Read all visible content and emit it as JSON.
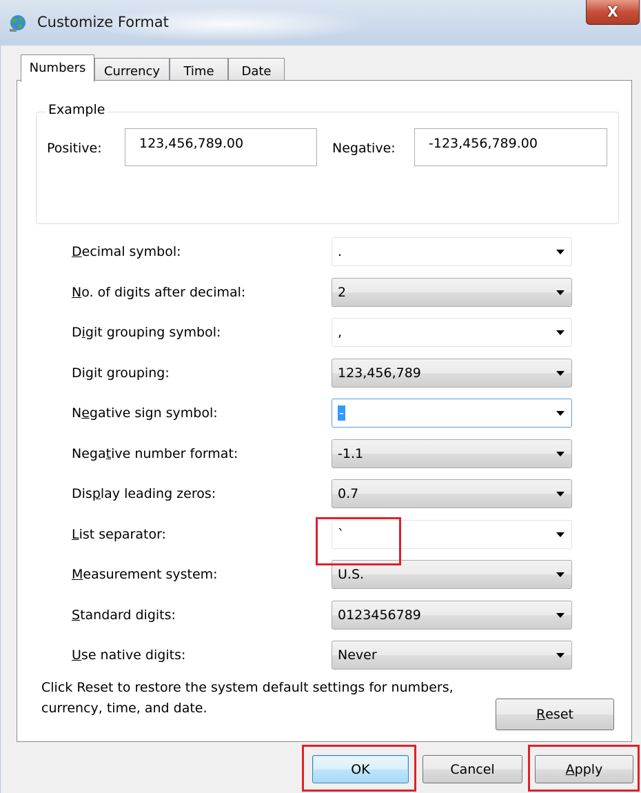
{
  "window": {
    "title": "Customize Format",
    "close_label": "X"
  },
  "tabs": [
    {
      "label": "Numbers",
      "active": true
    },
    {
      "label": "Currency",
      "active": false
    },
    {
      "label": "Time",
      "active": false
    },
    {
      "label": "Date",
      "active": false
    }
  ],
  "example": {
    "legend": "Example",
    "positive_label": "Positive:",
    "positive_value": "123,456,789.00",
    "negative_label": "Negative:",
    "negative_value": "-123,456,789.00"
  },
  "settings": [
    {
      "pre": "",
      "key": "D",
      "post": "ecimal symbol:",
      "value": ".",
      "style": "edit"
    },
    {
      "pre": "",
      "key": "N",
      "post": "o. of digits after decimal:",
      "value": "2",
      "style": "list"
    },
    {
      "pre": "D",
      "key": "i",
      "post": "git grouping symbol:",
      "value": ",",
      "style": "edit"
    },
    {
      "pre": "Di",
      "key": "g",
      "post": "it grouping:",
      "value": "123,456,789",
      "style": "list"
    },
    {
      "pre": "N",
      "key": "e",
      "post": "gative sign symbol:",
      "value": "-",
      "style": "edit-focused"
    },
    {
      "pre": "Nega",
      "key": "t",
      "post": "ive number format:",
      "value": "-1.1",
      "style": "list"
    },
    {
      "pre": "Dis",
      "key": "p",
      "post": "lay leading zeros:",
      "value": "0.7",
      "style": "list"
    },
    {
      "pre": "",
      "key": "L",
      "post": "ist separator:",
      "value": "`",
      "style": "edit"
    },
    {
      "pre": "",
      "key": "M",
      "post": "easurement system:",
      "value": "U.S.",
      "style": "list"
    },
    {
      "pre": "",
      "key": "S",
      "post": "tandard digits:",
      "value": "0123456789",
      "style": "list"
    },
    {
      "pre": "",
      "key": "U",
      "post": "se native digits:",
      "value": "Never",
      "style": "list"
    }
  ],
  "reset": {
    "description": "Click Reset to restore the system default settings for numbers, currency, time, and date.",
    "button_key": "R",
    "button_rest": "eset"
  },
  "buttons": {
    "ok": "OK",
    "cancel": "Cancel",
    "apply_key": "A",
    "apply_rest": "pply"
  },
  "colors": {
    "highlight": "#e0202a",
    "selection": "#3399ff",
    "default_button_border": "#3c7fb1"
  }
}
